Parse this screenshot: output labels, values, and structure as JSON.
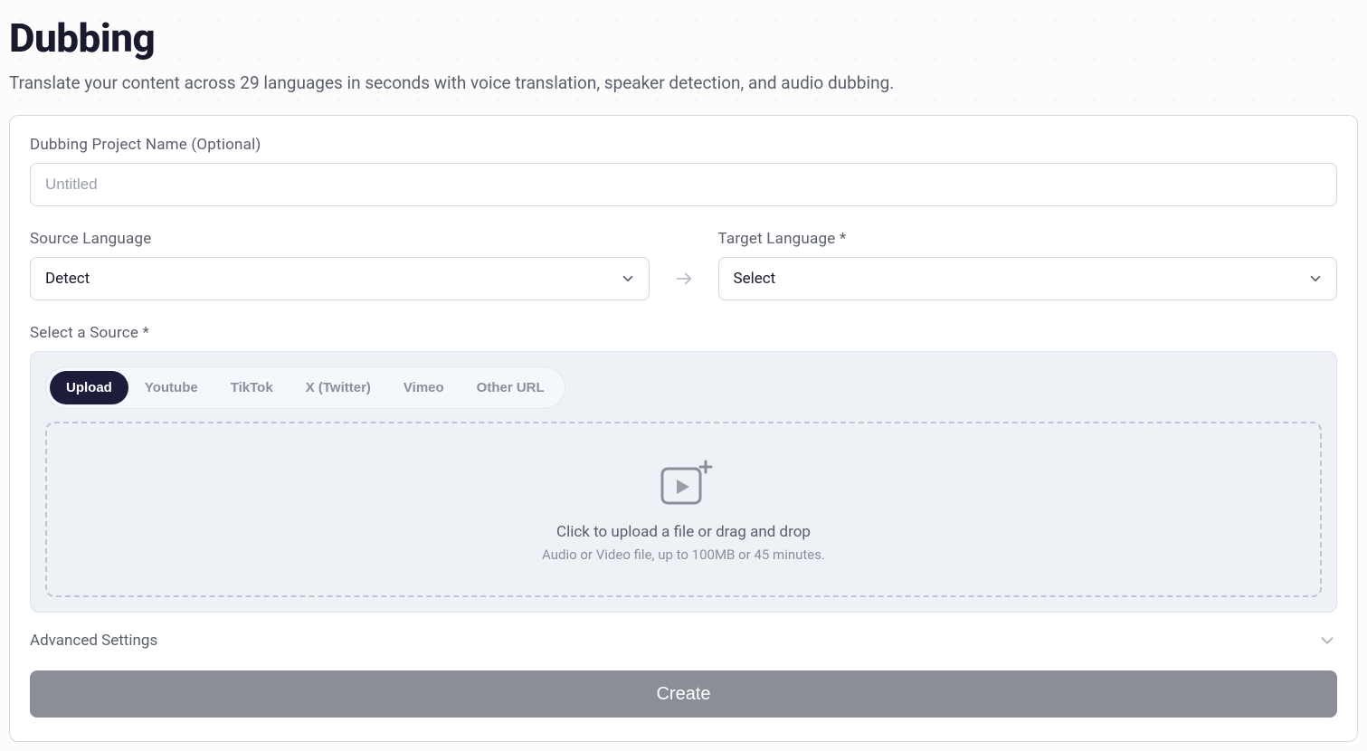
{
  "page": {
    "title": "Dubbing",
    "subtitle": "Translate your content across 29 languages in seconds with voice translation, speaker detection, and audio dubbing."
  },
  "form": {
    "project_name_label": "Dubbing Project Name (Optional)",
    "project_name_placeholder": "Untitled",
    "source_language_label": "Source Language",
    "source_language_value": "Detect",
    "target_language_label": "Target Language *",
    "target_language_value": "Select",
    "select_source_label": "Select a Source *",
    "tabs": {
      "upload": "Upload",
      "youtube": "Youtube",
      "tiktok": "TikTok",
      "xtwitter": "X (Twitter)",
      "vimeo": "Vimeo",
      "other": "Other URL"
    },
    "dropzone": {
      "title": "Click to upload a file or drag and drop",
      "subtitle": "Audio or Video file, up to 100MB or 45 minutes."
    },
    "advanced_label": "Advanced Settings",
    "create_label": "Create"
  }
}
